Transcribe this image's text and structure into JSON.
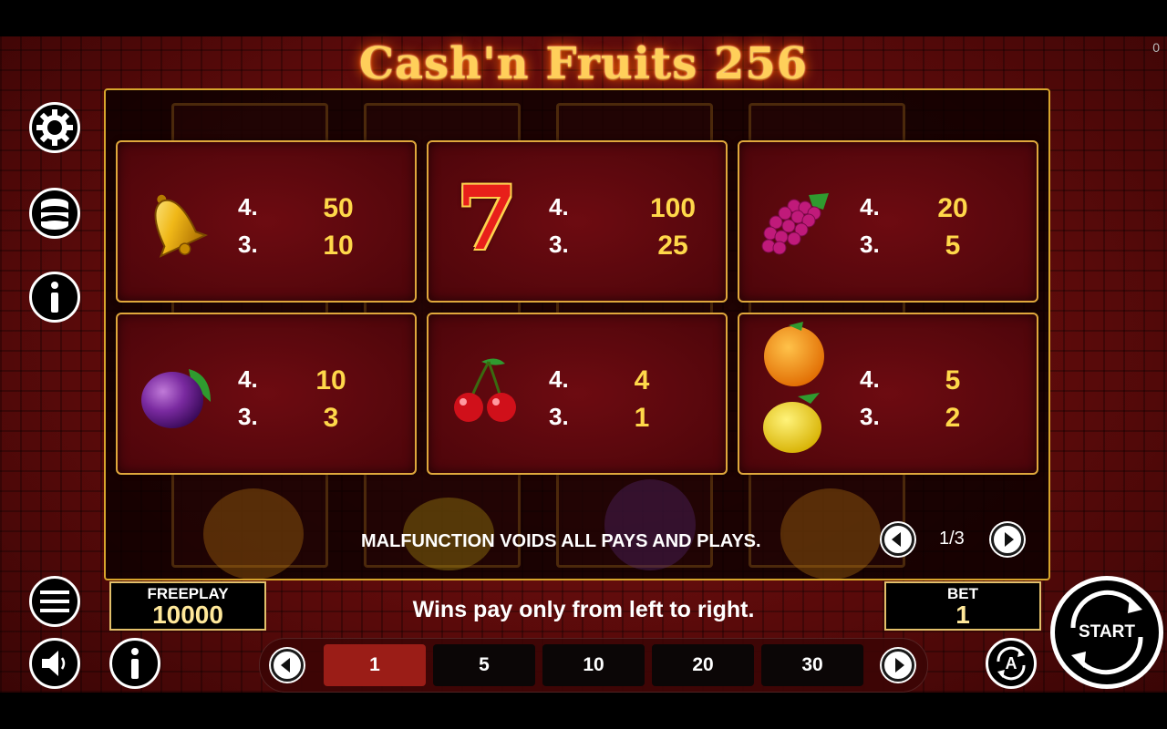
{
  "title": "Cash'n Fruits 256",
  "corner_counter": "0",
  "paytable": [
    {
      "symbol": "bell-icon",
      "rows": [
        {
          "n": "4.",
          "v": "50"
        },
        {
          "n": "3.",
          "v": "10"
        }
      ]
    },
    {
      "symbol": "seven-icon",
      "seven_text": "7",
      "rows": [
        {
          "n": "4.",
          "v": "100"
        },
        {
          "n": "3.",
          "v": "25"
        }
      ]
    },
    {
      "symbol": "grapes-icon",
      "rows": [
        {
          "n": "4.",
          "v": "20"
        },
        {
          "n": "3.",
          "v": "5"
        }
      ]
    },
    {
      "symbol": "plum-icon",
      "rows": [
        {
          "n": "4.",
          "v": "10"
        },
        {
          "n": "3.",
          "v": "3"
        }
      ]
    },
    {
      "symbol": "cherry-icon",
      "rows": [
        {
          "n": "4.",
          "v": "4"
        },
        {
          "n": "3.",
          "v": "1"
        }
      ]
    },
    {
      "symbol": "orange-lemon-icon",
      "rows": [
        {
          "n": "4.",
          "v": "5"
        },
        {
          "n": "3.",
          "v": "2"
        }
      ]
    }
  ],
  "malfunction_text": "MALFUNCTION VOIDS ALL PAYS AND PLAYS.",
  "page_indicator": "1/3",
  "freeplay": {
    "label": "FREEPLAY",
    "value": "10000"
  },
  "bet": {
    "label": "BET",
    "value": "1"
  },
  "wins_text": "Wins pay only from left to right.",
  "bet_options": [
    "1",
    "5",
    "10",
    "20",
    "30"
  ],
  "selected_bet": "1",
  "start_label": "START",
  "autoplay_label": "A",
  "colors": {
    "gold": "#d7a52c",
    "value_yellow": "#ffd84a",
    "active_bet": "#9b1d17"
  }
}
